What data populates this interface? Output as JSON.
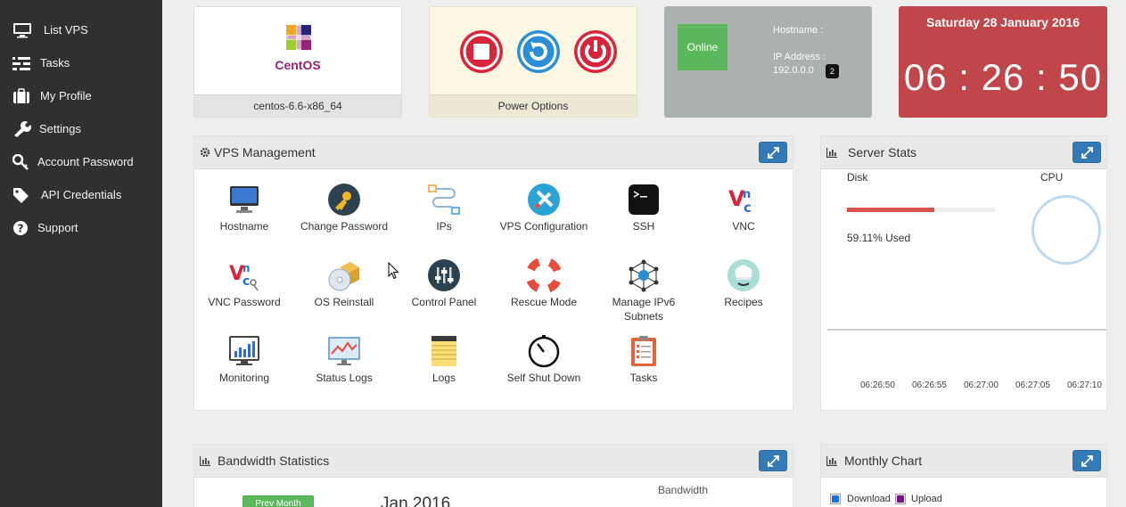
{
  "sidebar": {
    "items": [
      {
        "label": "List VPS",
        "icon": "monitor-icon"
      },
      {
        "label": "Tasks",
        "icon": "tasks-icon"
      },
      {
        "label": "My Profile",
        "icon": "briefcase-icon"
      },
      {
        "label": "Settings",
        "icon": "wrench-icon"
      },
      {
        "label": "Account Password",
        "icon": "key-icon"
      },
      {
        "label": "API Credentials",
        "icon": "tags-icon"
      },
      {
        "label": "Support",
        "icon": "question-circle-icon"
      }
    ]
  },
  "os_card": {
    "logo_text": "CentOS",
    "caption": "centos-6.6-x86_64"
  },
  "power_card": {
    "caption": "Power Options",
    "buttons": [
      "stop",
      "restart",
      "power-off"
    ]
  },
  "status_card": {
    "status": "Online",
    "hostname_label": "Hostname :",
    "ip_label": "IP Address :",
    "ip_value": "192.0.0.0",
    "ip_count": "2"
  },
  "clock_card": {
    "date": "Saturday 28 January 2016",
    "hours": "06",
    "minutes": "26",
    "seconds": "50"
  },
  "vps_management": {
    "title": "VPS Management",
    "items": [
      "Hostname",
      "Change Password",
      "IPs",
      "VPS Configuration",
      "SSH",
      "VNC",
      "VNC Password",
      "OS Reinstall",
      "Control Panel",
      "Rescue Mode",
      "Manage IPv6\nSubnets",
      "Recipes",
      "Monitoring",
      "Status Logs",
      "Logs",
      "Self Shut Down",
      "Tasks"
    ]
  },
  "server_stats": {
    "title": "Server Stats",
    "disk_label": "Disk",
    "disk_used_pct": 59.11,
    "disk_used_text": "59.11% Used",
    "cpu_label": "CPU",
    "times": [
      "06:26:50",
      "06:26:55",
      "06:27:00",
      "06:27:05",
      "06:27:10"
    ]
  },
  "bandwidth": {
    "title": "Bandwidth Statistics",
    "prev_button": "Prev Month",
    "month": "Jan 2016",
    "bandwidth_label": "Bandwidth"
  },
  "monthly_chart": {
    "title": "Monthly Chart",
    "legend": [
      {
        "label": "Download",
        "color": "#1b6fe0"
      },
      {
        "label": "Upload",
        "color": "#7d0f8f"
      }
    ]
  },
  "colors": {
    "sidebar": "#2f3130",
    "online": "#5cb85c",
    "clock": "#c0464a",
    "accent_blue": "#337ab7",
    "power_red": "#d9243a",
    "power_blue": "#2b8fd6",
    "disk_bar": "#d9534f"
  }
}
